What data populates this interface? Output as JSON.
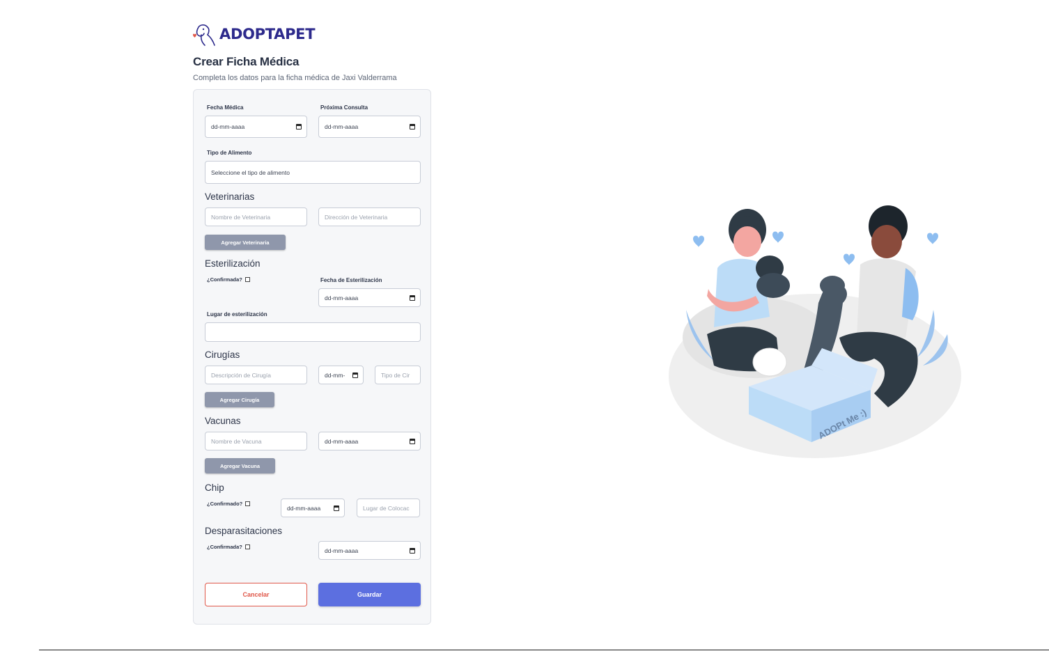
{
  "brand": {
    "name": "ADOPTAPET"
  },
  "page": {
    "title": "Crear Ficha Médica",
    "subtitle": "Completa los datos para la ficha médica de Jaxi Valderrama"
  },
  "form": {
    "fecha_medica": {
      "label": "Fecha Médica",
      "value": "dd-mm-aaaa"
    },
    "proxima_consulta": {
      "label": "Próxima Consulta",
      "value": "dd-mm-aaaa"
    },
    "tipo_alimento": {
      "label": "Tipo de Alimento",
      "value": "Seleccione el tipo de alimento"
    },
    "veterinarias": {
      "title": "Veterinarias",
      "nombre_placeholder": "Nombre de Veterinaria",
      "direccion_placeholder": "Dirección de Veterinaria",
      "add_label": "Agregar Veterinaria"
    },
    "esterilizacion": {
      "title": "Esterilización",
      "confirmada_label": "¿Confirmada?",
      "fecha_label": "Fecha de Esterilización",
      "fecha_value": "dd-mm-aaaa",
      "lugar_label": "Lugar de esterilización",
      "lugar_value": ""
    },
    "cirugias": {
      "title": "Cirugías",
      "descripcion_placeholder": "Descripción de Cirugía",
      "fecha_value": "dd-mm-",
      "tipo_placeholder": "Tipo de Cir",
      "add_label": "Agregar Cirugía"
    },
    "vacunas": {
      "title": "Vacunas",
      "nombre_placeholder": "Nombre de Vacuna",
      "fecha_value": "dd-mm-aaaa",
      "add_label": "Agregar Vacuna"
    },
    "chip": {
      "title": "Chip",
      "confirmado_label": "¿Confirmado?",
      "fecha_value": "dd-mm-aaaa",
      "lugar_placeholder": "Lugar de Colocac"
    },
    "desparasitaciones": {
      "title": "Desparasitaciones",
      "confirmada_label": "¿Confirmada?",
      "fecha_value": "dd-mm-aaaa"
    },
    "actions": {
      "cancel_label": "Cancelar",
      "save_label": "Guardar"
    }
  },
  "illustration": {
    "box_text": "ADOPt Me :)"
  },
  "colors": {
    "brand": "#2d2a8c",
    "primary": "#5c6fe0",
    "cancel": "#e0584a",
    "secondary_button": "#8f97ab",
    "card_background": "#f6f7f9"
  }
}
